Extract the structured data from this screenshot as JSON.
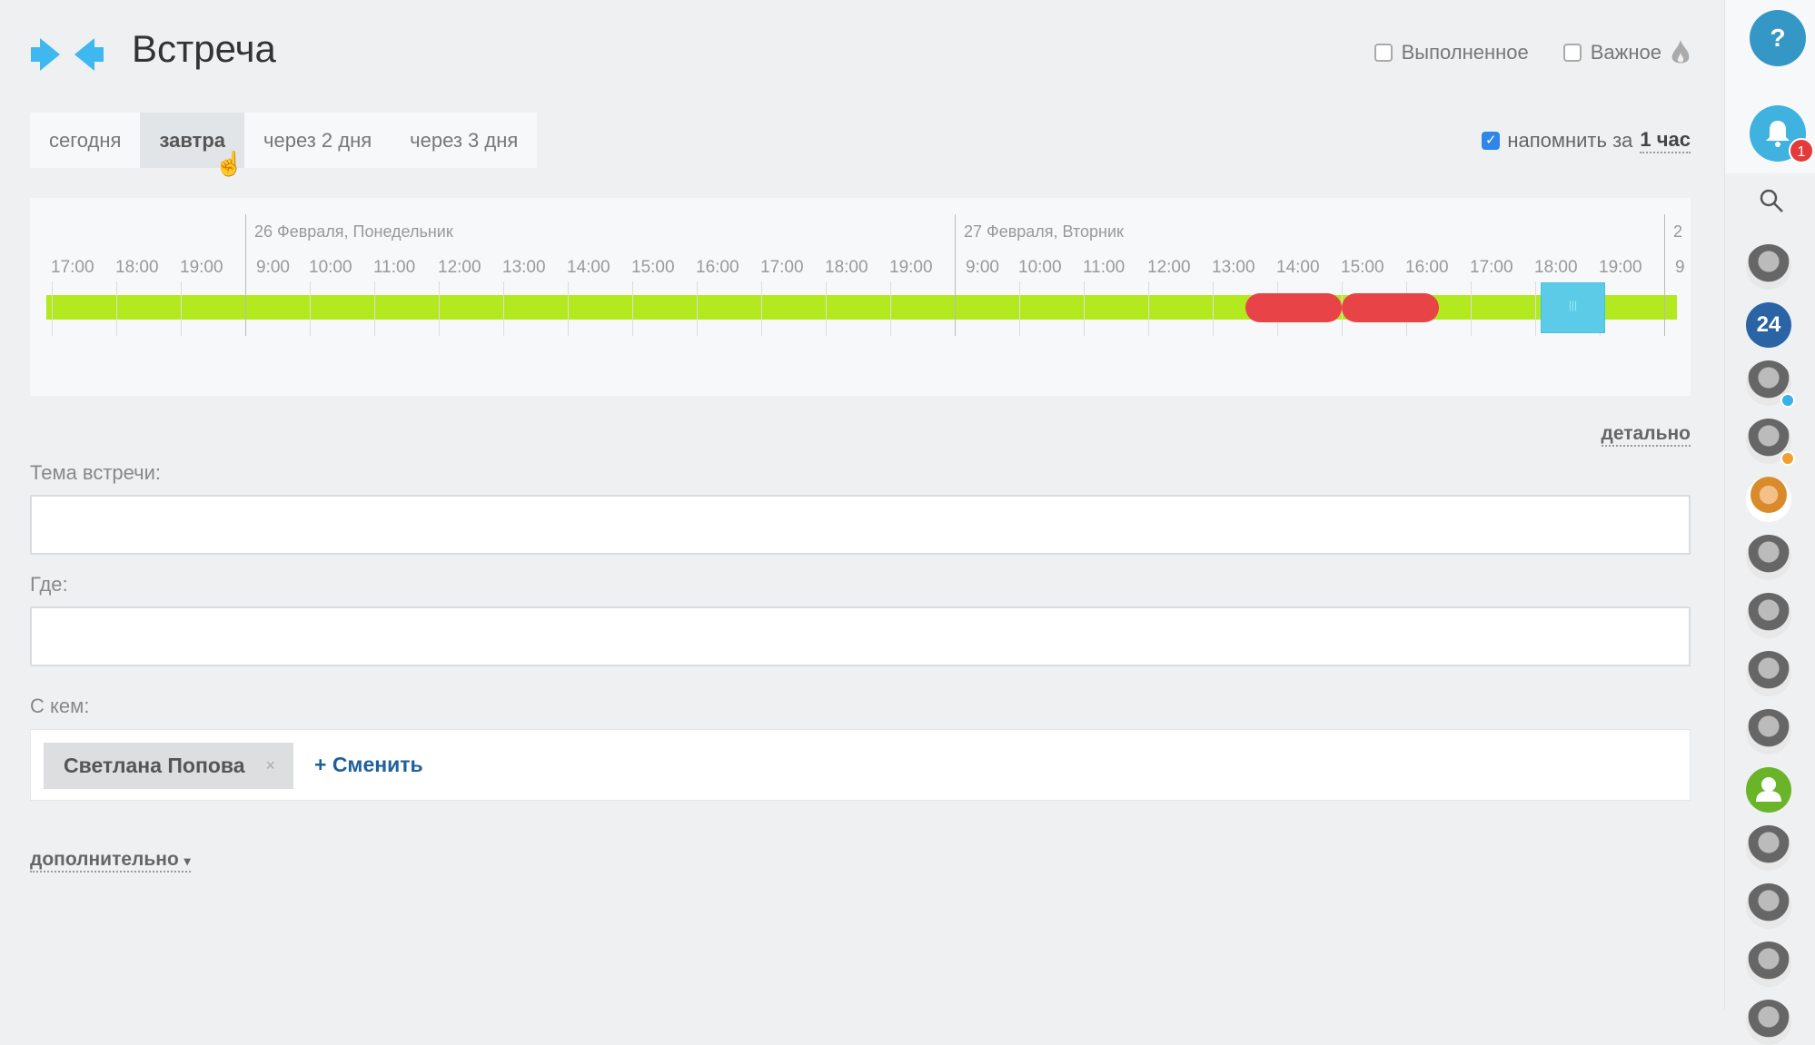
{
  "header": {
    "title": "Встреча",
    "logo_icon": "meeting-arrows-icon",
    "accent": "#3fb8ef"
  },
  "options": {
    "done_label": "Выполненное",
    "done_checked": false,
    "important_label": "Важное",
    "important_checked": false,
    "important_icon": "flame-icon"
  },
  "tabs": [
    {
      "label": "сегодня",
      "active": false
    },
    {
      "label": "завтра",
      "active": true
    },
    {
      "label": "через 2 дня",
      "active": false
    },
    {
      "label": "через 3 дня",
      "active": false
    }
  ],
  "remind": {
    "checked": true,
    "label": "напомнить за",
    "value": "1 час"
  },
  "timeline": {
    "days": [
      {
        "label": "",
        "hours": [
          "17:00",
          "18:00",
          "19:00"
        ]
      },
      {
        "label": "26 Февраля, Понедельник",
        "hours": [
          "9:00",
          "10:00",
          "11:00",
          "12:00",
          "13:00",
          "14:00",
          "15:00",
          "16:00",
          "17:00",
          "18:00",
          "19:00"
        ]
      },
      {
        "label": "27 Февраля, Вторник",
        "hours": [
          "9:00",
          "10:00",
          "11:00",
          "12:00",
          "13:00",
          "14:00",
          "15:00",
          "16:00",
          "17:00",
          "18:00",
          "19:00"
        ]
      },
      {
        "label": "2",
        "hours": [
          "9"
        ]
      }
    ],
    "busy": [
      {
        "day": 2,
        "from": "13:30",
        "to": "15:00"
      },
      {
        "day": 2,
        "from": "15:00",
        "to": "16:30"
      }
    ],
    "selected": {
      "day": 2,
      "from": "18:00",
      "to": "19:00"
    },
    "colors": {
      "free": "#b3ea1f",
      "busy": "#e84448",
      "selected": "#5ccbe8"
    }
  },
  "detail_link": "детально",
  "form": {
    "topic_label": "Тема встречи:",
    "topic_value": "",
    "where_label": "Где:",
    "where_value": "",
    "with_label": "С кем:",
    "participant": "Светлана Попова",
    "remove_glyph": "×",
    "change_label": "+ Сменить"
  },
  "more_label": "дополнительно",
  "more_arrow": "▾",
  "sidebar": {
    "help_glyph": "?",
    "notifications_count": "1",
    "contacts": [
      {
        "type": "photo"
      },
      {
        "type": "number",
        "text": "24"
      },
      {
        "type": "photo",
        "status": "#3ab0e6"
      },
      {
        "type": "photo",
        "status": "#f0a030"
      },
      {
        "type": "cartoon"
      },
      {
        "type": "photo"
      },
      {
        "type": "photo"
      },
      {
        "type": "photo"
      },
      {
        "type": "photo"
      },
      {
        "type": "default"
      },
      {
        "type": "photo"
      },
      {
        "type": "photo"
      },
      {
        "type": "photo"
      },
      {
        "type": "photo"
      }
    ]
  }
}
